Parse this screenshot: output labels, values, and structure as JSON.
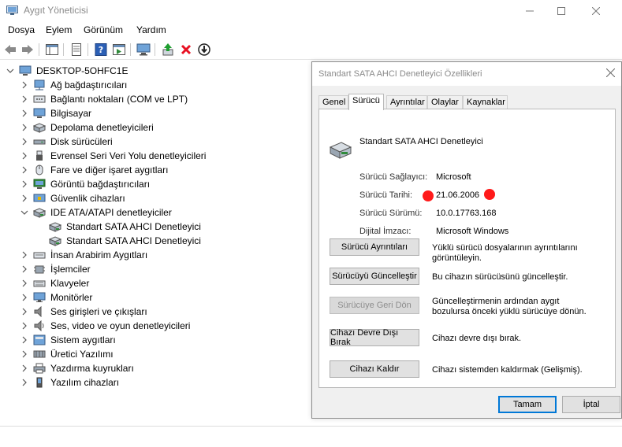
{
  "window": {
    "title": "Aygıt Yöneticisi"
  },
  "menu": [
    "Dosya",
    "Eylem",
    "Görünüm",
    "Yardım"
  ],
  "tree": {
    "root": "DESKTOP-5OHFC1E",
    "items": [
      {
        "label": "Ağ bağdaştırıcıları",
        "icon": "network-adapter-icon",
        "expanded": false
      },
      {
        "label": "Bağlantı noktaları (COM ve LPT)",
        "icon": "port-icon",
        "expanded": false
      },
      {
        "label": "Bilgisayar",
        "icon": "computer-icon",
        "expanded": false
      },
      {
        "label": "Depolama denetleyicileri",
        "icon": "storage-controller-icon",
        "expanded": false
      },
      {
        "label": "Disk sürücüleri",
        "icon": "disk-drive-icon",
        "expanded": false
      },
      {
        "label": "Evrensel Seri Veri Yolu denetleyicileri",
        "icon": "usb-icon",
        "expanded": false
      },
      {
        "label": "Fare ve diğer işaret aygıtları",
        "icon": "mouse-icon",
        "expanded": false
      },
      {
        "label": "Görüntü bağdaştırıcıları",
        "icon": "display-adapter-icon",
        "expanded": false
      },
      {
        "label": "Güvenlik cihazları",
        "icon": "security-device-icon",
        "expanded": false
      },
      {
        "label": "IDE ATA/ATAPI denetleyiciler",
        "icon": "ide-controller-icon",
        "expanded": true,
        "children": [
          "Standart SATA AHCI Denetleyici",
          "Standart SATA AHCI Denetleyici"
        ]
      },
      {
        "label": "İnsan Arabirim Aygıtları",
        "icon": "hid-icon",
        "expanded": false
      },
      {
        "label": "İşlemciler",
        "icon": "processor-icon",
        "expanded": false
      },
      {
        "label": "Klavyeler",
        "icon": "keyboard-icon",
        "expanded": false
      },
      {
        "label": "Monitörler",
        "icon": "monitor-icon",
        "expanded": false
      },
      {
        "label": "Ses girişleri ve çıkışları",
        "icon": "audio-io-icon",
        "expanded": false
      },
      {
        "label": "Ses, video ve oyun denetleyicileri",
        "icon": "sound-controller-icon",
        "expanded": false
      },
      {
        "label": "Sistem aygıtları",
        "icon": "system-device-icon",
        "expanded": false
      },
      {
        "label": "Üretici Yazılımı",
        "icon": "firmware-icon",
        "expanded": false
      },
      {
        "label": "Yazdırma kuyrukları",
        "icon": "print-queue-icon",
        "expanded": false
      },
      {
        "label": "Yazılım cihazları",
        "icon": "software-device-icon",
        "expanded": false
      }
    ]
  },
  "dialog": {
    "title": "Standart SATA AHCI Denetleyici Özellikleri",
    "tabs": [
      "Genel",
      "Sürücü",
      "Ayrıntılar",
      "Olaylar",
      "Kaynaklar"
    ],
    "active_tab": "Sürücü",
    "device_name": "Standart SATA AHCI Denetleyici",
    "fields": [
      {
        "label": "Sürücü Sağlayıcı:",
        "value": "Microsoft"
      },
      {
        "label": "Sürücü Tarihi:",
        "value": "21.06.2006"
      },
      {
        "label": "Sürücü Sürümü:",
        "value": "10.0.17763.168"
      },
      {
        "label": "Dijital İmzacı:",
        "value": "Microsoft Windows"
      }
    ],
    "actions": [
      {
        "label": "Sürücü Ayrıntıları",
        "desc": "Yüklü sürücü dosyalarının ayrıntılarını görüntüleyin.",
        "enabled": true
      },
      {
        "label": "Sürücüyü Güncelleştir",
        "desc": "Bu cihazın sürücüsünü güncelleştir.",
        "enabled": true
      },
      {
        "label": "Sürücüye Geri Dön",
        "desc": "Güncelleştirmenin ardından aygıt bozulursa önceki yüklü sürücüye dönün.",
        "enabled": false
      },
      {
        "label": "Cihazı Devre Dışı Bırak",
        "desc": "Cihazı devre dışı bırak.",
        "enabled": true
      },
      {
        "label": "Cihazı Kaldır",
        "desc": "Cihazı sistemden kaldırmak (Gelişmiş).",
        "enabled": true
      }
    ],
    "ok_label": "Tamam",
    "cancel_label": "İptal"
  },
  "colors": {
    "annotation_dot": "#ff1a1a",
    "focus_border": "#0078d7",
    "remove_icon": "#e81123",
    "update_icon": "#1e9e2f"
  }
}
